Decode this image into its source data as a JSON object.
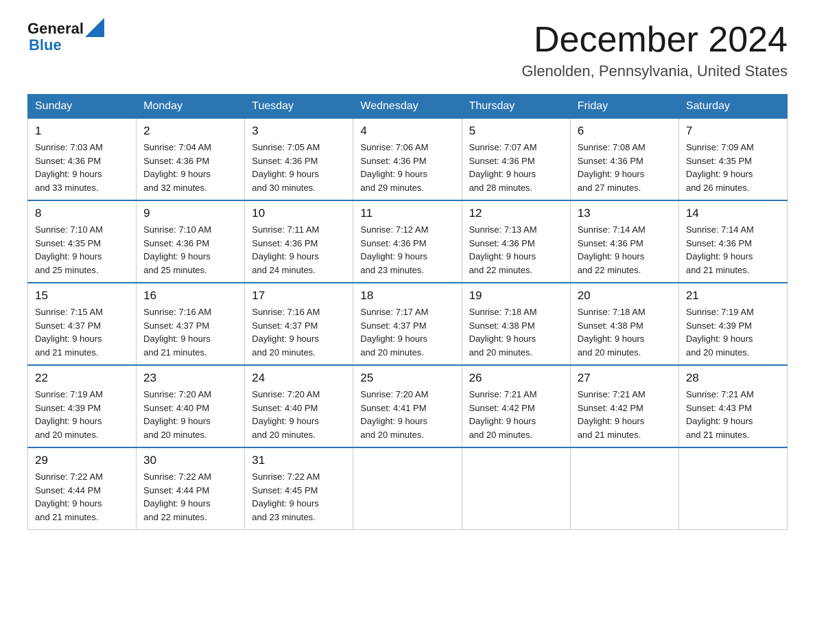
{
  "header": {
    "logo_general": "General",
    "logo_blue": "Blue",
    "month_year": "December 2024",
    "location": "Glenolden, Pennsylvania, United States"
  },
  "days_of_week": [
    "Sunday",
    "Monday",
    "Tuesday",
    "Wednesday",
    "Thursday",
    "Friday",
    "Saturday"
  ],
  "weeks": [
    [
      {
        "day": "1",
        "sunrise": "7:03 AM",
        "sunset": "4:36 PM",
        "daylight": "9 hours and 33 minutes."
      },
      {
        "day": "2",
        "sunrise": "7:04 AM",
        "sunset": "4:36 PM",
        "daylight": "9 hours and 32 minutes."
      },
      {
        "day": "3",
        "sunrise": "7:05 AM",
        "sunset": "4:36 PM",
        "daylight": "9 hours and 30 minutes."
      },
      {
        "day": "4",
        "sunrise": "7:06 AM",
        "sunset": "4:36 PM",
        "daylight": "9 hours and 29 minutes."
      },
      {
        "day": "5",
        "sunrise": "7:07 AM",
        "sunset": "4:36 PM",
        "daylight": "9 hours and 28 minutes."
      },
      {
        "day": "6",
        "sunrise": "7:08 AM",
        "sunset": "4:36 PM",
        "daylight": "9 hours and 27 minutes."
      },
      {
        "day": "7",
        "sunrise": "7:09 AM",
        "sunset": "4:35 PM",
        "daylight": "9 hours and 26 minutes."
      }
    ],
    [
      {
        "day": "8",
        "sunrise": "7:10 AM",
        "sunset": "4:35 PM",
        "daylight": "9 hours and 25 minutes."
      },
      {
        "day": "9",
        "sunrise": "7:10 AM",
        "sunset": "4:36 PM",
        "daylight": "9 hours and 25 minutes."
      },
      {
        "day": "10",
        "sunrise": "7:11 AM",
        "sunset": "4:36 PM",
        "daylight": "9 hours and 24 minutes."
      },
      {
        "day": "11",
        "sunrise": "7:12 AM",
        "sunset": "4:36 PM",
        "daylight": "9 hours and 23 minutes."
      },
      {
        "day": "12",
        "sunrise": "7:13 AM",
        "sunset": "4:36 PM",
        "daylight": "9 hours and 22 minutes."
      },
      {
        "day": "13",
        "sunrise": "7:14 AM",
        "sunset": "4:36 PM",
        "daylight": "9 hours and 22 minutes."
      },
      {
        "day": "14",
        "sunrise": "7:14 AM",
        "sunset": "4:36 PM",
        "daylight": "9 hours and 21 minutes."
      }
    ],
    [
      {
        "day": "15",
        "sunrise": "7:15 AM",
        "sunset": "4:37 PM",
        "daylight": "9 hours and 21 minutes."
      },
      {
        "day": "16",
        "sunrise": "7:16 AM",
        "sunset": "4:37 PM",
        "daylight": "9 hours and 21 minutes."
      },
      {
        "day": "17",
        "sunrise": "7:16 AM",
        "sunset": "4:37 PM",
        "daylight": "9 hours and 20 minutes."
      },
      {
        "day": "18",
        "sunrise": "7:17 AM",
        "sunset": "4:37 PM",
        "daylight": "9 hours and 20 minutes."
      },
      {
        "day": "19",
        "sunrise": "7:18 AM",
        "sunset": "4:38 PM",
        "daylight": "9 hours and 20 minutes."
      },
      {
        "day": "20",
        "sunrise": "7:18 AM",
        "sunset": "4:38 PM",
        "daylight": "9 hours and 20 minutes."
      },
      {
        "day": "21",
        "sunrise": "7:19 AM",
        "sunset": "4:39 PM",
        "daylight": "9 hours and 20 minutes."
      }
    ],
    [
      {
        "day": "22",
        "sunrise": "7:19 AM",
        "sunset": "4:39 PM",
        "daylight": "9 hours and 20 minutes."
      },
      {
        "day": "23",
        "sunrise": "7:20 AM",
        "sunset": "4:40 PM",
        "daylight": "9 hours and 20 minutes."
      },
      {
        "day": "24",
        "sunrise": "7:20 AM",
        "sunset": "4:40 PM",
        "daylight": "9 hours and 20 minutes."
      },
      {
        "day": "25",
        "sunrise": "7:20 AM",
        "sunset": "4:41 PM",
        "daylight": "9 hours and 20 minutes."
      },
      {
        "day": "26",
        "sunrise": "7:21 AM",
        "sunset": "4:42 PM",
        "daylight": "9 hours and 20 minutes."
      },
      {
        "day": "27",
        "sunrise": "7:21 AM",
        "sunset": "4:42 PM",
        "daylight": "9 hours and 21 minutes."
      },
      {
        "day": "28",
        "sunrise": "7:21 AM",
        "sunset": "4:43 PM",
        "daylight": "9 hours and 21 minutes."
      }
    ],
    [
      {
        "day": "29",
        "sunrise": "7:22 AM",
        "sunset": "4:44 PM",
        "daylight": "9 hours and 21 minutes."
      },
      {
        "day": "30",
        "sunrise": "7:22 AM",
        "sunset": "4:44 PM",
        "daylight": "9 hours and 22 minutes."
      },
      {
        "day": "31",
        "sunrise": "7:22 AM",
        "sunset": "4:45 PM",
        "daylight": "9 hours and 23 minutes."
      },
      null,
      null,
      null,
      null
    ]
  ],
  "labels": {
    "sunrise": "Sunrise:",
    "sunset": "Sunset:",
    "daylight": "Daylight:"
  }
}
